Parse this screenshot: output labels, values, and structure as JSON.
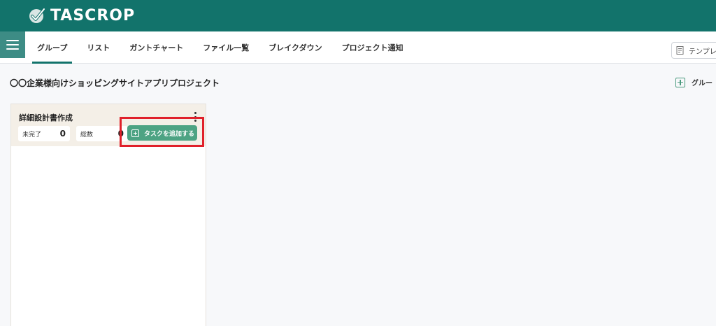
{
  "app": {
    "brand": "TASCROP",
    "logo_icon": "check-badge-icon",
    "brand_color": "#12736b"
  },
  "nav": {
    "menu_icon": "hamburger-icon",
    "tabs": [
      {
        "label": "グループ",
        "active": true
      },
      {
        "label": "リスト",
        "active": false
      },
      {
        "label": "ガントチャート",
        "active": false
      },
      {
        "label": "ファイル一覧",
        "active": false
      },
      {
        "label": "ブレイクダウン",
        "active": false
      },
      {
        "label": "プロジェクト通知",
        "active": false
      }
    ],
    "template_button": "テンプレ"
  },
  "project": {
    "title": "〇〇企業様向けショッピングサイトアプリプロジェクト",
    "add_group_label": "グルー"
  },
  "group": {
    "title": "詳細設計書作成",
    "incomplete_label": "未完了",
    "incomplete_count": "0",
    "total_label": "総数",
    "total_count": "0",
    "add_task_label": "タスクを追加する",
    "accent_color": "#4da383"
  },
  "annotation": {
    "highlight_color": "#e0202a"
  }
}
